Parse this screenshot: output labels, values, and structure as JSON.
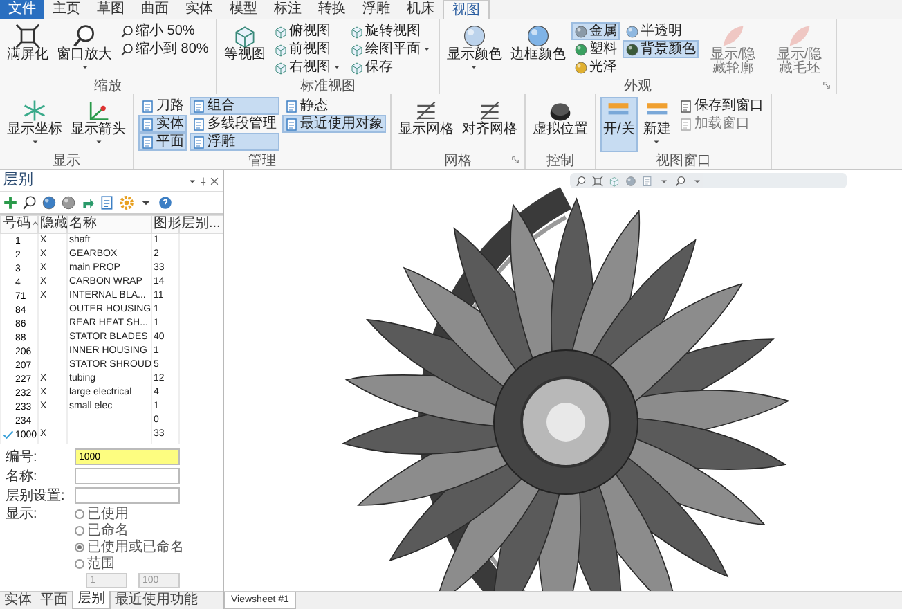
{
  "menu_tabs": [
    {
      "label": "文件",
      "selected": false,
      "kind": "file"
    },
    {
      "label": "主页",
      "selected": false,
      "kind": "tab"
    },
    {
      "label": "草图",
      "selected": false,
      "kind": "tab"
    },
    {
      "label": "曲面",
      "selected": false,
      "kind": "tab"
    },
    {
      "label": "实体",
      "selected": false,
      "kind": "tab"
    },
    {
      "label": "模型",
      "selected": false,
      "kind": "tab"
    },
    {
      "label": "标注",
      "selected": false,
      "kind": "tab"
    },
    {
      "label": "转换",
      "selected": false,
      "kind": "tab"
    },
    {
      "label": "浮雕",
      "selected": false,
      "kind": "tab"
    },
    {
      "label": "机床",
      "selected": false,
      "kind": "tab"
    },
    {
      "label": "视图",
      "selected": true,
      "kind": "tab"
    }
  ],
  "ribbon_groups": [
    {
      "label": "缩放",
      "items": [
        {
          "kind": "large",
          "label": "满屏化"
        },
        {
          "kind": "large",
          "label": "窗口放大",
          "dropdown": true
        },
        {
          "kind": "small",
          "label": "缩小 50%"
        },
        {
          "kind": "small",
          "label": "缩小到 80%"
        }
      ]
    },
    {
      "label": "标准视图",
      "items": [
        {
          "kind": "large",
          "label": "等视图"
        },
        {
          "kind": "small",
          "label": "俯视图"
        },
        {
          "kind": "small",
          "label": "前视图"
        },
        {
          "kind": "small",
          "label": "右视图",
          "dropdown": true
        },
        {
          "kind": "small",
          "label": "旋转视图"
        },
        {
          "kind": "small",
          "label": "绘图平面",
          "dropdown": true
        },
        {
          "kind": "small",
          "label": "保存"
        }
      ]
    },
    {
      "label": "外观",
      "launcher": true,
      "items": [
        {
          "kind": "large",
          "label": "显示颜色",
          "dropdown": true
        },
        {
          "kind": "large",
          "label": "边框颜色"
        },
        {
          "kind": "small",
          "label": "金属",
          "selected": true
        },
        {
          "kind": "small",
          "label": "塑料",
          "selected": false
        },
        {
          "kind": "small",
          "label": "光泽",
          "selected": false
        },
        {
          "kind": "small",
          "label": "半透明",
          "selected": false
        },
        {
          "kind": "small",
          "label": "背景颜色",
          "selected": true
        },
        {
          "kind": "large",
          "label": "显示/隐藏轮廓",
          "disabled": true
        },
        {
          "kind": "large",
          "label": "显示/隐藏毛坯",
          "disabled": true
        }
      ]
    },
    {
      "label": "显示",
      "items": [
        {
          "kind": "large",
          "label": "显示坐标",
          "dropdown": true
        },
        {
          "kind": "large",
          "label": "显示箭头",
          "dropdown": true
        }
      ]
    },
    {
      "label": "管理",
      "items": [
        {
          "kind": "small",
          "label": "刀路",
          "selected": false
        },
        {
          "kind": "small",
          "label": "实体",
          "selected": true
        },
        {
          "kind": "small",
          "label": "平面",
          "selected": true
        },
        {
          "kind": "small",
          "label": "组合",
          "selected": true
        },
        {
          "kind": "small",
          "label": "多线段管理",
          "selected": false
        },
        {
          "kind": "small",
          "label": "浮雕",
          "selected": true
        },
        {
          "kind": "small",
          "label": "静态",
          "selected": false
        },
        {
          "kind": "small",
          "label": "最近使用对象",
          "selected": true
        }
      ]
    },
    {
      "label": "网格",
      "launcher": true,
      "items": [
        {
          "kind": "large",
          "label": "显示网格"
        },
        {
          "kind": "large",
          "label": "对齐网格"
        }
      ]
    },
    {
      "label": "控制",
      "items": [
        {
          "kind": "large",
          "label": "虚拟位置"
        }
      ]
    },
    {
      "label": "视图窗口",
      "items": [
        {
          "kind": "large",
          "label": "开/关",
          "selected": true
        },
        {
          "kind": "large",
          "label": "新建",
          "dropdown": true,
          "selected": false
        },
        {
          "kind": "small",
          "label": "保存到窗口",
          "disabled": false
        },
        {
          "kind": "small",
          "label": "加载窗口",
          "disabled": true
        }
      ]
    }
  ],
  "layers_panel": {
    "title": "层别",
    "columns": [
      {
        "label": "号码"
      },
      {
        "label": "隐藏"
      },
      {
        "label": "名称"
      },
      {
        "label": "图形"
      },
      {
        "label": "层别..."
      }
    ],
    "rows": [
      {
        "number": "1",
        "hidden": "X",
        "name": "shaft",
        "count": "1",
        "current": false
      },
      {
        "number": "2",
        "hidden": "X",
        "name": "GEARBOX",
        "count": "2",
        "current": false
      },
      {
        "number": "3",
        "hidden": "X",
        "name": "main PROP",
        "count": "33",
        "current": false
      },
      {
        "number": "4",
        "hidden": "X",
        "name": "CARBON WRAP",
        "count": "14",
        "current": false
      },
      {
        "number": "71",
        "hidden": "X",
        "name": "INTERNAL BLA...",
        "count": "11",
        "current": false
      },
      {
        "number": "84",
        "name": "OUTER HOUSING",
        "count": "1",
        "current": false
      },
      {
        "number": "86",
        "name": "REAR HEAT SH...",
        "count": "1",
        "current": false
      },
      {
        "number": "88",
        "name": "STATOR BLADES",
        "count": "40",
        "current": false
      },
      {
        "number": "206",
        "name": "INNER HOUSING",
        "count": "1",
        "current": false
      },
      {
        "number": "207",
        "name": "STATOR SHROUD",
        "count": "5",
        "current": false
      },
      {
        "number": "227",
        "hidden": "X",
        "name": "tubing",
        "count": "12",
        "current": false
      },
      {
        "number": "232",
        "hidden": "X",
        "name": "large electrical",
        "count": "4",
        "current": false
      },
      {
        "number": "233",
        "hidden": "X",
        "name": "small elec",
        "count": "1",
        "current": false
      },
      {
        "number": "234",
        "count": "0",
        "current": false
      },
      {
        "number": "1000",
        "hidden": "X",
        "count": "33",
        "current": true
      }
    ],
    "form": {
      "number_label": "编号:",
      "number_value": "1000",
      "name_label": "名称:",
      "settings_label": "层别设置:",
      "display_label": "显示:",
      "display_options": [
        {
          "label": "已使用",
          "selected": false
        },
        {
          "label": "已命名",
          "selected": false
        },
        {
          "label": "已使用或已命名",
          "selected": true
        },
        {
          "label": "范围",
          "selected": false
        }
      ],
      "range_from": "1",
      "range_to": "100",
      "range_disabled": true
    },
    "bottom_tabs": [
      {
        "label": "实体",
        "selected": false
      },
      {
        "label": "平面",
        "selected": false
      },
      {
        "label": "层别",
        "selected": true
      },
      {
        "label": "最近使用功能",
        "selected": false
      }
    ]
  },
  "viewport": {
    "sheet_tab": "Viewsheet #1"
  }
}
